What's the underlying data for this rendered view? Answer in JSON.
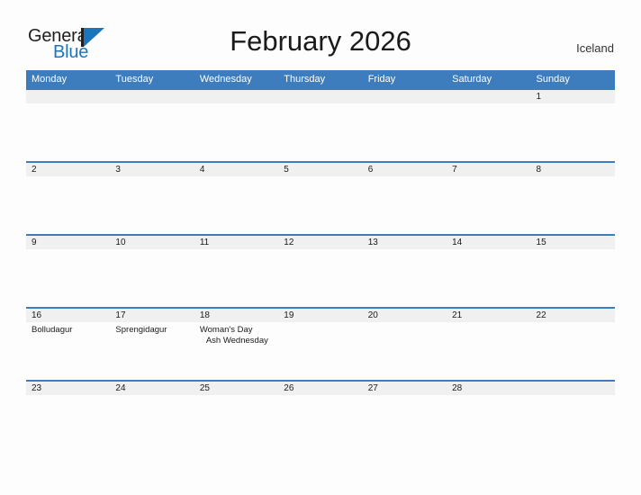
{
  "brand": {
    "name_part1": "General",
    "name_part2": "Blue",
    "flag_color": "#1b75bb"
  },
  "header": {
    "title": "February 2026",
    "locale": "Iceland"
  },
  "calendar": {
    "weekday_headers": [
      "Monday",
      "Tuesday",
      "Wednesday",
      "Thursday",
      "Friday",
      "Saturday",
      "Sunday"
    ],
    "accent_color": "#3d7cbd",
    "band_color": "#f0f0f0",
    "weeks": [
      [
        {
          "day": ""
        },
        {
          "day": ""
        },
        {
          "day": ""
        },
        {
          "day": ""
        },
        {
          "day": ""
        },
        {
          "day": ""
        },
        {
          "day": "1"
        }
      ],
      [
        {
          "day": "2"
        },
        {
          "day": "3"
        },
        {
          "day": "4"
        },
        {
          "day": "5"
        },
        {
          "day": "6"
        },
        {
          "day": "7"
        },
        {
          "day": "8"
        }
      ],
      [
        {
          "day": "9"
        },
        {
          "day": "10"
        },
        {
          "day": "11"
        },
        {
          "day": "12"
        },
        {
          "day": "13"
        },
        {
          "day": "14"
        },
        {
          "day": "15"
        }
      ],
      [
        {
          "day": "16",
          "events": [
            "Bolludagur"
          ]
        },
        {
          "day": "17",
          "events": [
            "Sprengidagur"
          ]
        },
        {
          "day": "18",
          "events": [
            "Woman's Day",
            "Ash Wednesday"
          ]
        },
        {
          "day": "19"
        },
        {
          "day": "20"
        },
        {
          "day": "21"
        },
        {
          "day": "22"
        }
      ],
      [
        {
          "day": "23"
        },
        {
          "day": "24"
        },
        {
          "day": "25"
        },
        {
          "day": "26"
        },
        {
          "day": "27"
        },
        {
          "day": "28"
        },
        {
          "day": ""
        }
      ]
    ]
  }
}
